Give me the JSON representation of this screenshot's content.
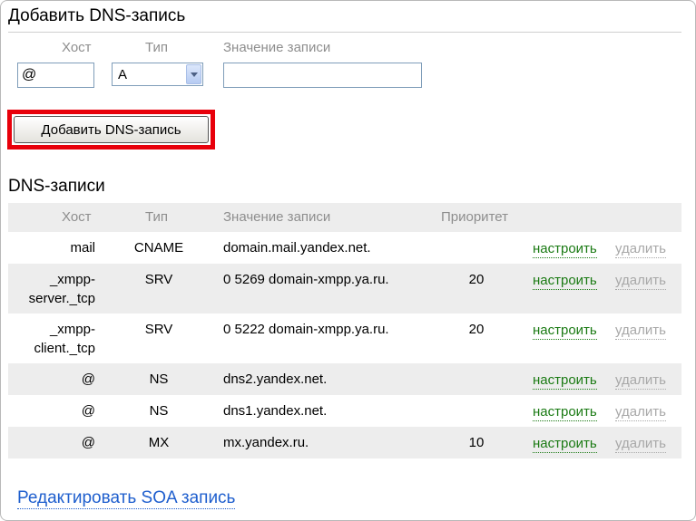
{
  "add_section": {
    "title": "Добавить DNS-запись",
    "labels": {
      "host": "Хост",
      "type": "Тип",
      "value": "Значение записи"
    },
    "host_value": "@",
    "type_value": "A",
    "value_value": "",
    "button_label": "Добавить DNS-запись",
    "highlight_color": "#e8000b"
  },
  "records_section": {
    "title": "DNS-записи",
    "columns": {
      "host": "Хост",
      "type": "Тип",
      "value": "Значение записи",
      "priority": "Приоритет"
    },
    "rows": [
      {
        "host1": "mail",
        "host2": "",
        "type": "CNAME",
        "value": "domain.mail.yandex.net.",
        "priority": "",
        "configure": "настроить",
        "delete": "удалить"
      },
      {
        "host1": "_xmpp-",
        "host2": "server._tcp",
        "type": "SRV",
        "value": "0 5269 domain-xmpp.ya.ru.",
        "priority": "20",
        "configure": "настроить",
        "delete": "удалить"
      },
      {
        "host1": "_xmpp-",
        "host2": "client._tcp",
        "type": "SRV",
        "value": "0 5222 domain-xmpp.ya.ru.",
        "priority": "20",
        "configure": "настроить",
        "delete": "удалить"
      },
      {
        "host1": "@",
        "host2": "",
        "type": "NS",
        "value": "dns2.yandex.net.",
        "priority": "",
        "configure": "настроить",
        "delete": "удалить"
      },
      {
        "host1": "@",
        "host2": "",
        "type": "NS",
        "value": "dns1.yandex.net.",
        "priority": "",
        "configure": "настроить",
        "delete": "удалить"
      },
      {
        "host1": "@",
        "host2": "",
        "type": "MX",
        "value": "mx.yandex.ru.",
        "priority": "10",
        "configure": "настроить",
        "delete": "удалить"
      }
    ]
  },
  "soa_link": "Редактировать SOA запись",
  "colors": {
    "configure_link": "#1a7a13",
    "delete_link": "#a8a8a8",
    "soa_link": "#1f5fce",
    "header_bg": "#ededed"
  }
}
